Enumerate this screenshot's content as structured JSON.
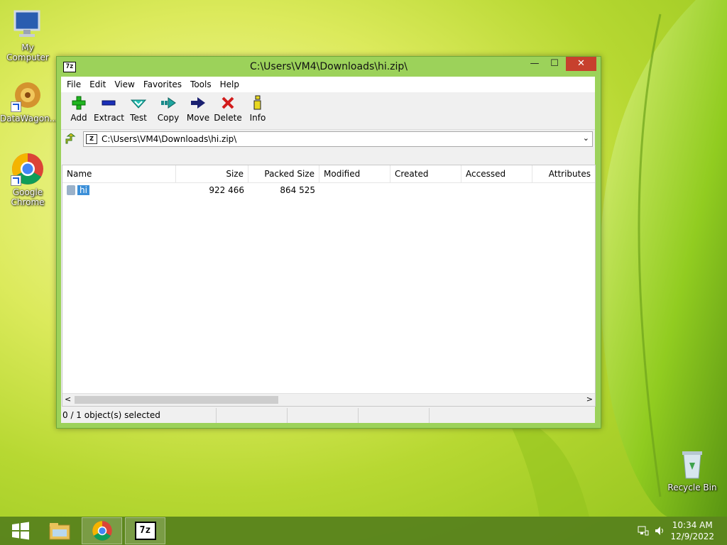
{
  "desktop": {
    "icons": [
      {
        "label": "My Computer"
      },
      {
        "label": "DataWagon..."
      },
      {
        "label": "Google Chrome"
      },
      {
        "label": "Recycle Bin"
      }
    ]
  },
  "window": {
    "title": "C:\\Users\\VM4\\Downloads\\hi.zip\\",
    "app_icon_text": "7z",
    "controls": {
      "minimize": "—",
      "maximize": "☐",
      "close": "✕"
    }
  },
  "menu": [
    "File",
    "Edit",
    "View",
    "Favorites",
    "Tools",
    "Help"
  ],
  "toolbar": [
    {
      "label": "Add",
      "icon": "add-icon"
    },
    {
      "label": "Extract",
      "icon": "extract-icon"
    },
    {
      "label": "Test",
      "icon": "test-icon"
    },
    {
      "label": "Copy",
      "icon": "copy-icon"
    },
    {
      "label": "Move",
      "icon": "move-icon"
    },
    {
      "label": "Delete",
      "icon": "delete-icon"
    },
    {
      "label": "Info",
      "icon": "info-icon"
    }
  ],
  "address": {
    "path": "C:\\Users\\VM4\\Downloads\\hi.zip\\"
  },
  "columns": [
    "Name",
    "Size",
    "Packed Size",
    "Modified",
    "Created",
    "Accessed",
    "Attributes"
  ],
  "rows": [
    {
      "name": "hi",
      "size": "922 466",
      "packed": "864 525",
      "modified": "",
      "created": "",
      "accessed": "",
      "attributes": ""
    }
  ],
  "status": {
    "selected": "0 / 1 object(s) selected"
  },
  "taskbar": {
    "time": "10:34 AM",
    "date": "12/9/2022"
  },
  "colors": {
    "window_frame": "#9cd25a",
    "close_button": "#c7402d",
    "selection": "#3b8fd8",
    "taskbar": "#56801c"
  }
}
